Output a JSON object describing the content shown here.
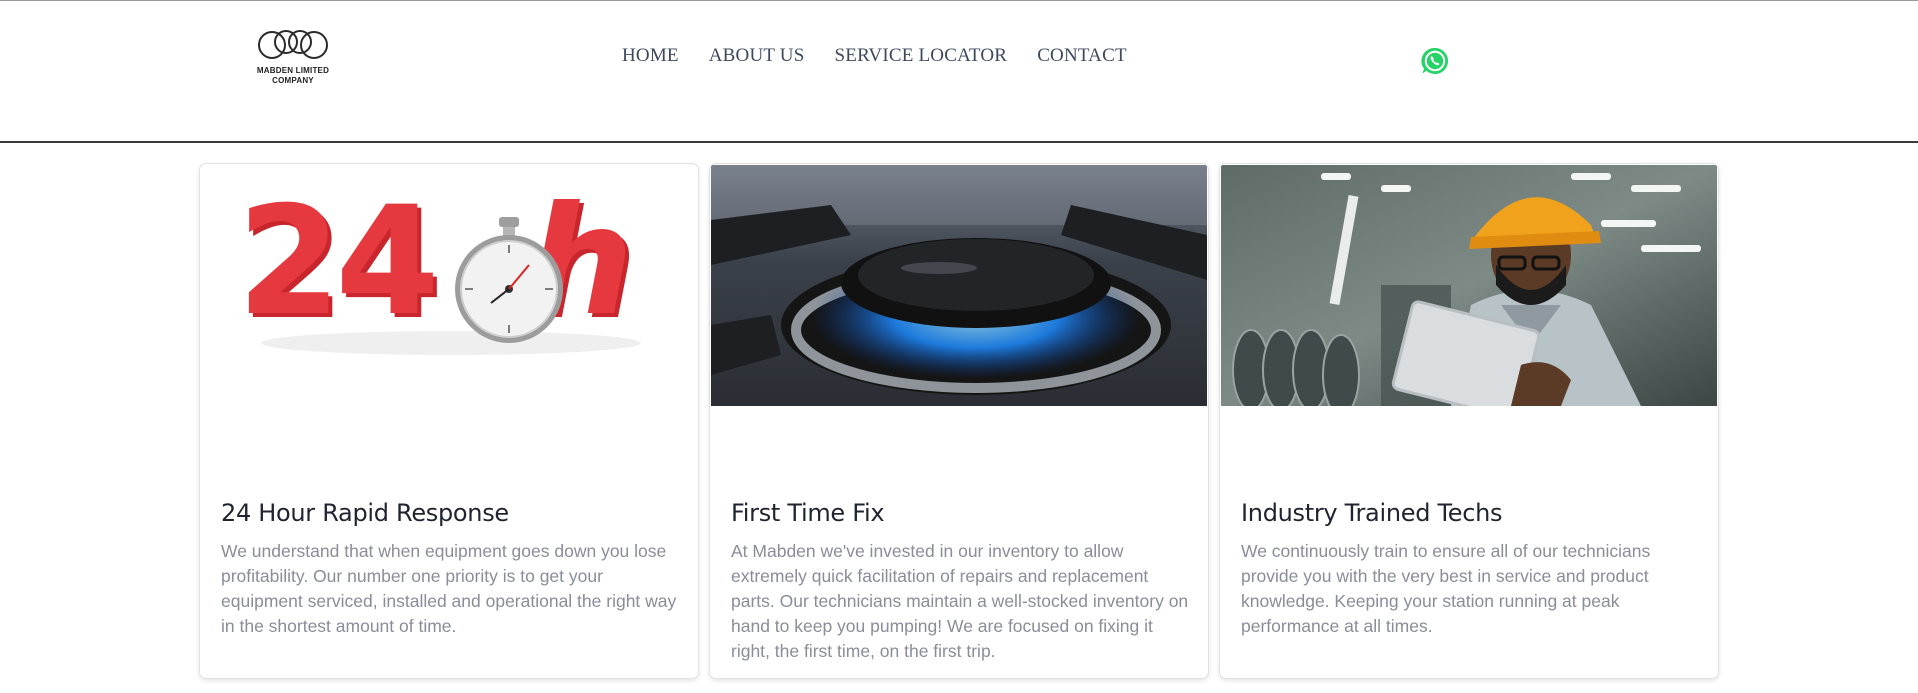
{
  "header": {
    "logo_text_line1": "MABDEN LIMITED",
    "logo_text_line2": "COMPANY",
    "nav": [
      {
        "label": "HOME"
      },
      {
        "label": "ABOUT US"
      },
      {
        "label": "SERVICE LOCATOR"
      },
      {
        "label": "CONTACT"
      }
    ],
    "whatsapp_icon": "whatsapp-icon"
  },
  "colors": {
    "nav_text": "#3d4a5c",
    "card_title": "#1f2430",
    "card_text": "#8a8d9a",
    "whatsapp_green": "#25d366"
  },
  "cards": [
    {
      "image": "24h-stopwatch-image",
      "title": "24 Hour Rapid Response",
      "text": "We understand that when equipment goes down you lose profitability. Our number one priority is to get your equipment serviced, installed and operational the right way in the shortest amount of time."
    },
    {
      "image": "gas-burner-flame-image",
      "title": "First Time Fix",
      "text": "At Mabden we've invested in our inventory to allow extremely quick facilitation of repairs and replacement parts. Our technicians maintain a well-stocked inventory on hand to keep you pumping! We are focused on fixing it right, the first time, on the first trip."
    },
    {
      "image": "technician-with-tablet-image",
      "title": "Industry Trained Techs",
      "text": "We continuously train to ensure all of our technicians provide you with the very best in service and product knowledge. Keeping your station running at peak performance at all times."
    }
  ]
}
